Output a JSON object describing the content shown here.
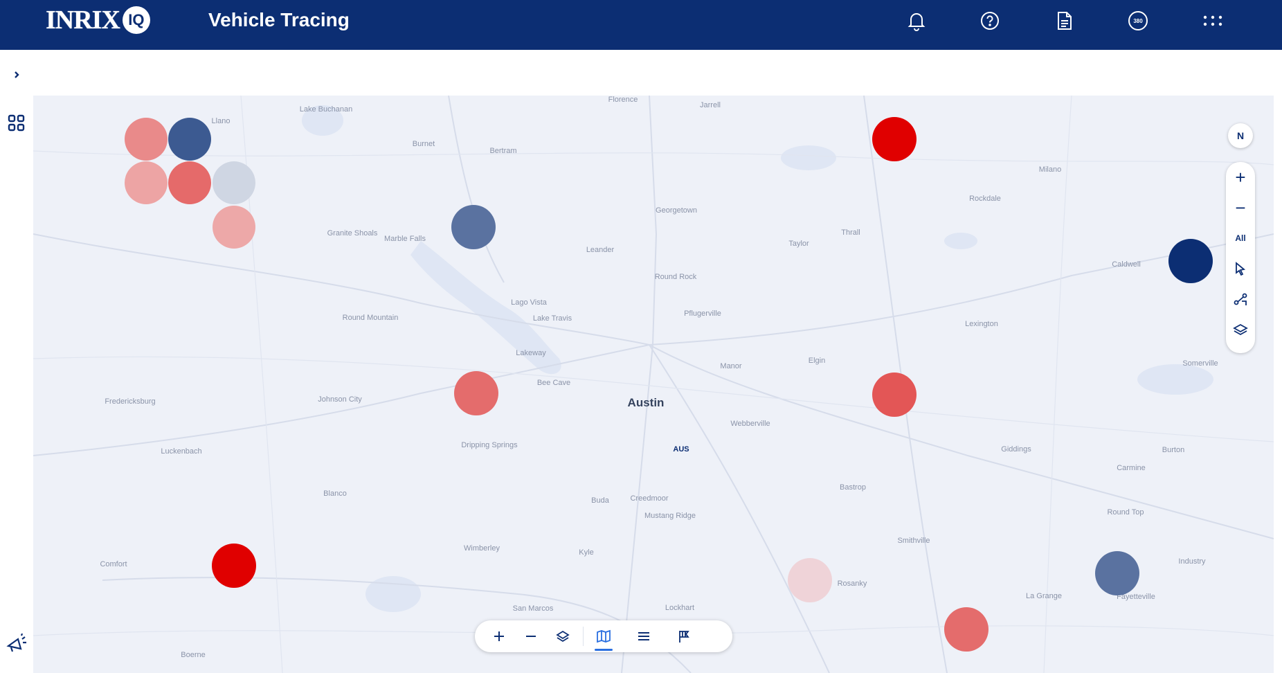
{
  "header": {
    "logo_text": "INRIX",
    "logo_badge": "IQ",
    "title": "Vehicle Tracing",
    "icons": [
      "bell-icon",
      "help-icon",
      "document-icon",
      "account-icon",
      "apps-grid-icon"
    ],
    "account_badge": "380"
  },
  "rail": {
    "items": [
      "expand-chevron-icon",
      "dashboard-grid-icon",
      "announcement-icon"
    ]
  },
  "map": {
    "major_label": "Austin",
    "airport_label": "AUS",
    "places": [
      "Lake Buchanan",
      "Florence",
      "Jarrell",
      "Burnet",
      "Bertram",
      "Georgetown",
      "Granite Shoals",
      "Marble Falls",
      "Leander",
      "Round Rock",
      "Taylor",
      "Thrall",
      "Rockdale",
      "Milano",
      "Lago Vista",
      "Lake Travis",
      "Pflugerville",
      "Round Mountain",
      "Lakeway",
      "Manor",
      "Elgin",
      "Bee Cave",
      "Fredericksburg",
      "Johnson City",
      "Webberville",
      "Dripping Springs",
      "Luckenbach",
      "Blanco",
      "Buda",
      "Creedmoor",
      "Mustang Ridge",
      "Bastrop",
      "Giddings",
      "Lexington",
      "Caldwell",
      "Comfort",
      "Wimberley",
      "Kyle",
      "San Marcos",
      "Lockhart",
      "Rosanky",
      "Smithville",
      "La Grange",
      "Round Top",
      "Carmine",
      "Burton",
      "Somerville",
      "Boerne",
      "Fayetteville",
      "Industry",
      "Llano"
    ],
    "controls": {
      "compass": "N",
      "zoom_in": "+",
      "zoom_out": "−",
      "all_label": "All"
    },
    "circle_colors": {
      "red_strong": "#e00000",
      "red_medium": "#e05a5a",
      "red_light": "#e98a8a",
      "pink_pale": "#efc9cf",
      "blue_dark": "#0c2e73",
      "blue_medium": "#4a6596",
      "gray_pale": "#cfd6e3"
    }
  },
  "bottom_toolbar": {
    "items": [
      "zoom-in-icon",
      "zoom-out-icon",
      "layers-icon",
      "map-view-icon",
      "list-view-icon",
      "flag-icon"
    ],
    "active": "map-view-icon"
  }
}
